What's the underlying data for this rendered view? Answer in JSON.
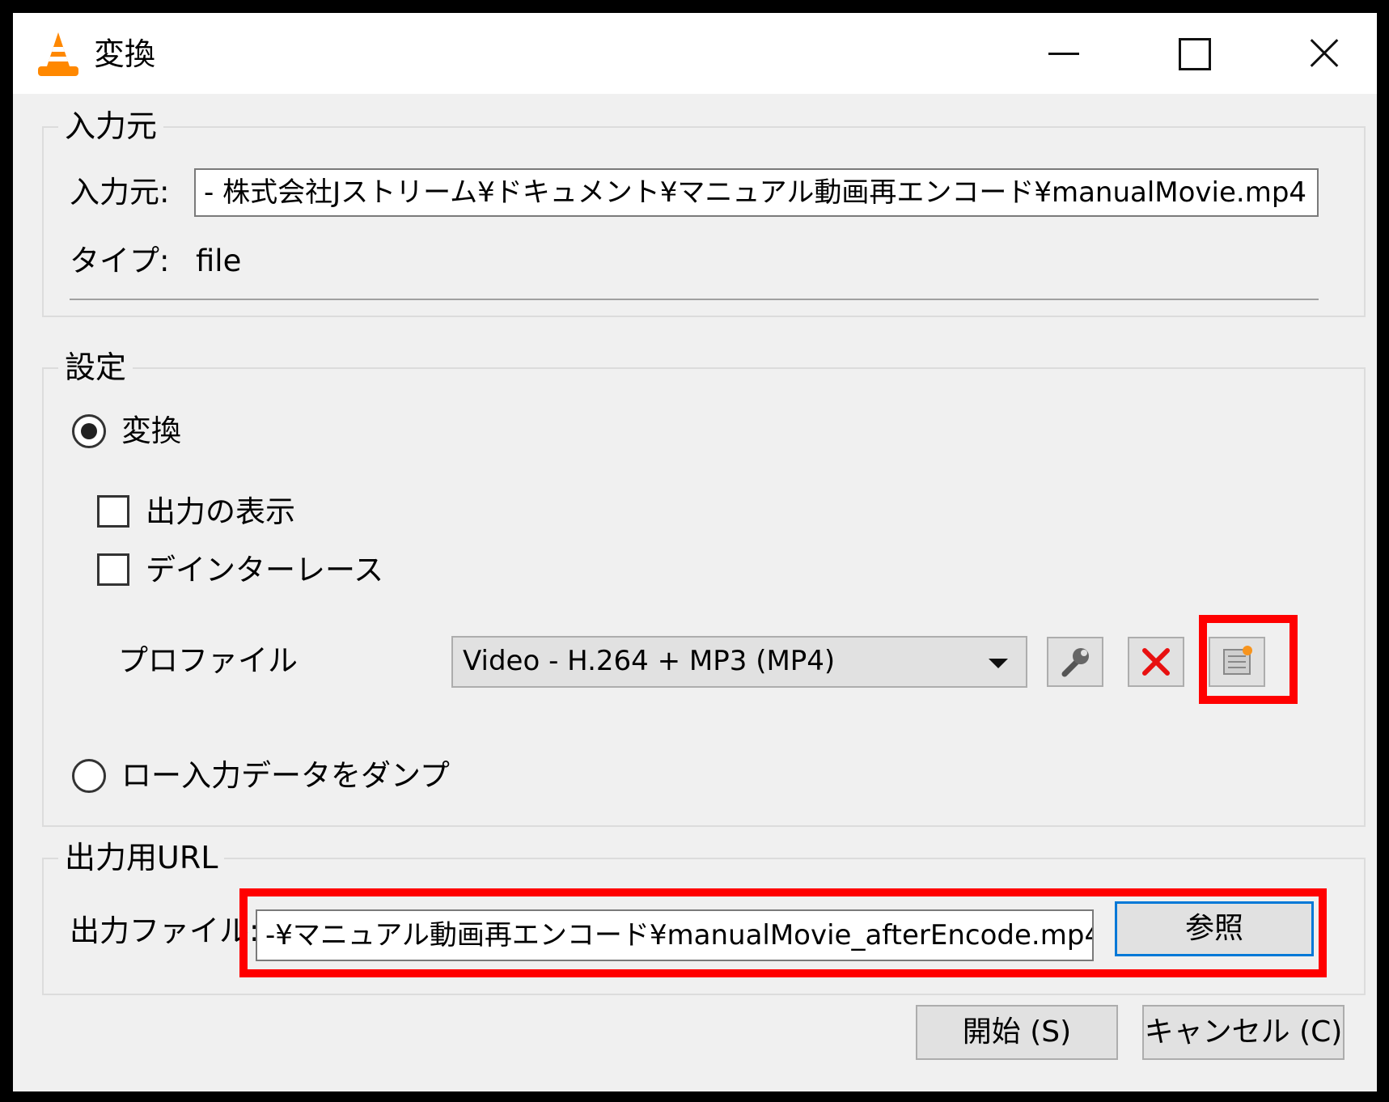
{
  "window": {
    "title": "変換",
    "icon": "vlc-cone-icon"
  },
  "source": {
    "group_label": "入力元",
    "source_label": "入力元:",
    "source_value": "- 株式会社Jストリーム¥ドキュメント¥マニュアル動画再エンコード¥manualMovie.mp4",
    "type_label": "タイプ:",
    "type_value": "file"
  },
  "settings": {
    "group_label": "設定",
    "convert_label": "変換",
    "show_output_label": "出力の表示",
    "deinterlace_label": "デインターレース",
    "profile_label": "プロファイル",
    "profile_value": "Video - H.264 + MP3 (MP4)",
    "dump_raw_label": "ロー入力データをダンプ"
  },
  "destination": {
    "group_label": "出力用URL",
    "file_label": "出力ファイル:",
    "file_value": "-¥マニュアル動画再エンコード¥manualMovie_afterEncode.mp4",
    "browse_label": "参照"
  },
  "footer": {
    "start_label": "開始 (S)",
    "cancel_label": "キャンセル (C)"
  },
  "colors": {
    "highlight": "#ff0000",
    "focus": "#0078d7",
    "dialog_bg": "#f0f0f0"
  }
}
